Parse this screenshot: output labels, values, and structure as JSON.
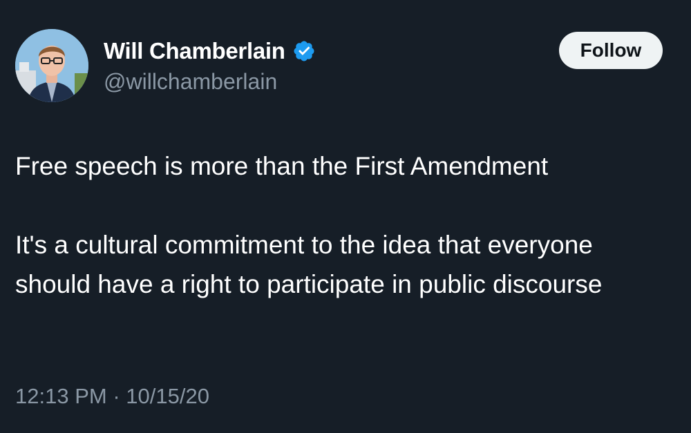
{
  "tweet": {
    "author": {
      "display_name": "Will Chamberlain",
      "handle": "@willchamberlain",
      "verified": true,
      "verified_icon": "verified-badge-icon",
      "verified_color": "#1d9bf0"
    },
    "follow_label": "Follow",
    "text": {
      "paragraph1": "Free speech is more than the First Amendment",
      "paragraph2": "It's a cultural commitment to the idea that everyone should have a right to participate in public discourse"
    },
    "time": "12:13 PM",
    "separator": "·",
    "date": "10/15/20"
  },
  "colors": {
    "background": "#161e27",
    "primary_text": "#ffffff",
    "secondary_text": "#8b98a5",
    "follow_bg": "#eff3f4",
    "follow_text": "#0f1419"
  }
}
